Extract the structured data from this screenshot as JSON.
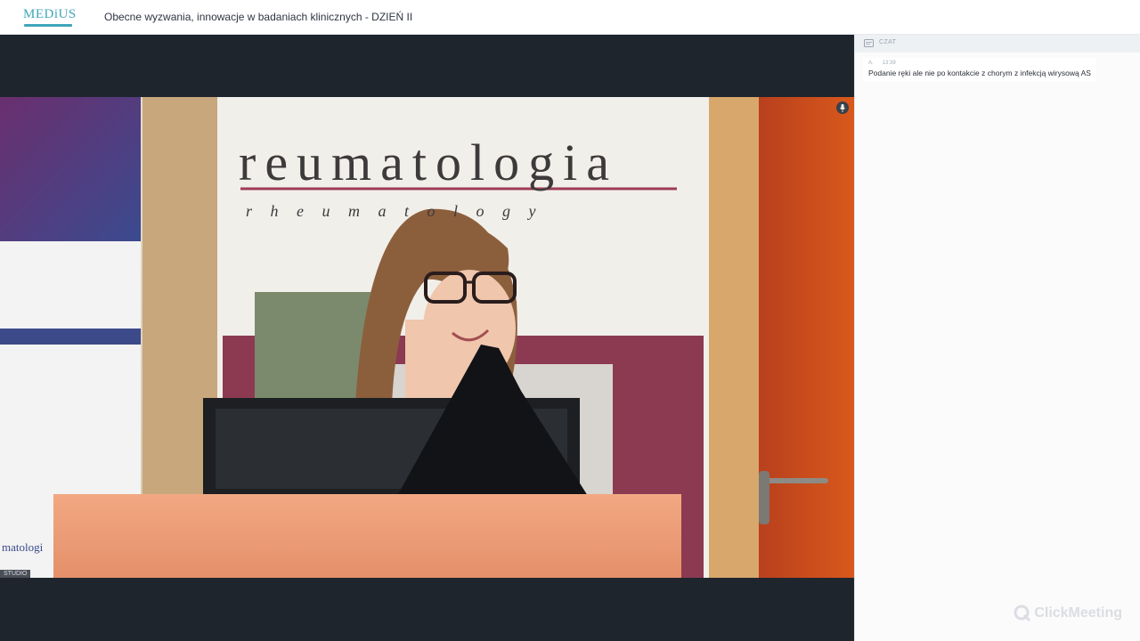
{
  "header": {
    "logo_text": "MEDiUS",
    "meeting_title": "Obecne wyzwania, innowacje w badaniach klinicznych - DZIEŃ II"
  },
  "video": {
    "banner_title": "reumatologia",
    "banner_subtitle": "r h e u m a t o l o g y",
    "side_banner_text": "matologi",
    "studio_label": "STUDIO"
  },
  "chat": {
    "header_label": "CZAT",
    "messages": [
      {
        "author": "A.",
        "time": "13:39",
        "text": "Podanie ręki ale nie po kontakcie z chorym z infekcją wirysową AS"
      }
    ]
  },
  "branding": {
    "watermark": "ClickMeeting"
  },
  "colors": {
    "stage_bg": "#1f252d",
    "accent": "#3fa6b9",
    "chat_header_bg": "#eef1f4"
  }
}
